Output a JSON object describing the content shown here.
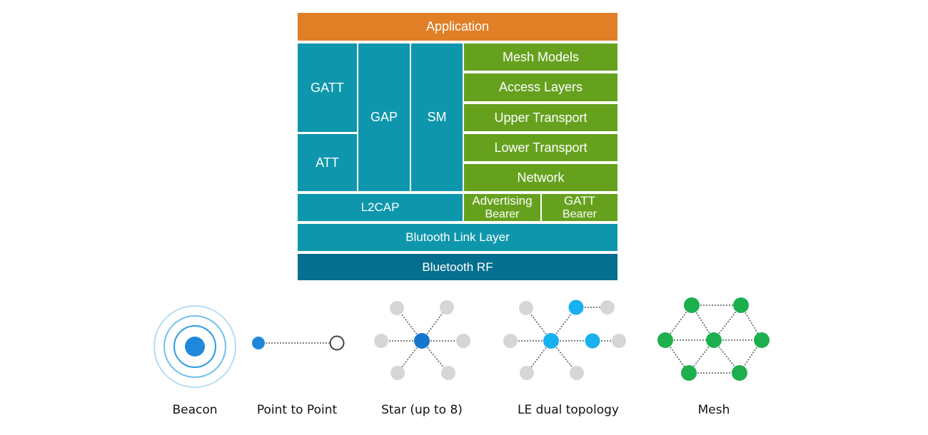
{
  "stack": {
    "application": "Application",
    "gatt": "GATT",
    "att": "ATT",
    "gap": "GAP",
    "sm": "SM",
    "mesh_models": "Mesh Models",
    "access_layers": "Access Layers",
    "upper_transport": "Upper Transport",
    "lower_transport": "Lower Transport",
    "network": "Network",
    "l2cap": "L2CAP",
    "advertising_bearer": [
      "Advertising",
      "Bearer"
    ],
    "gatt_bearer": [
      "GATT",
      "Bearer"
    ],
    "link_layer": "Blutooth Link Layer",
    "rf": "Bluetooth RF"
  },
  "colors": {
    "application": "#E07F26",
    "host": "#0E97AC",
    "mesh": "#66A11E",
    "rf": "#046F8E",
    "beacon": "#1E88DC",
    "le_dual_node": "#19B0F0",
    "mesh_node": "#1DAF4E",
    "inactive_node": "#D6D6D6"
  },
  "topologies": [
    {
      "name": "beacon",
      "label": "Beacon"
    },
    {
      "name": "point-to-point",
      "label": "Point to Point"
    },
    {
      "name": "star",
      "label": "Star (up to 8)"
    },
    {
      "name": "le-dual",
      "label": "LE dual topology"
    },
    {
      "name": "mesh",
      "label": "Mesh"
    }
  ]
}
